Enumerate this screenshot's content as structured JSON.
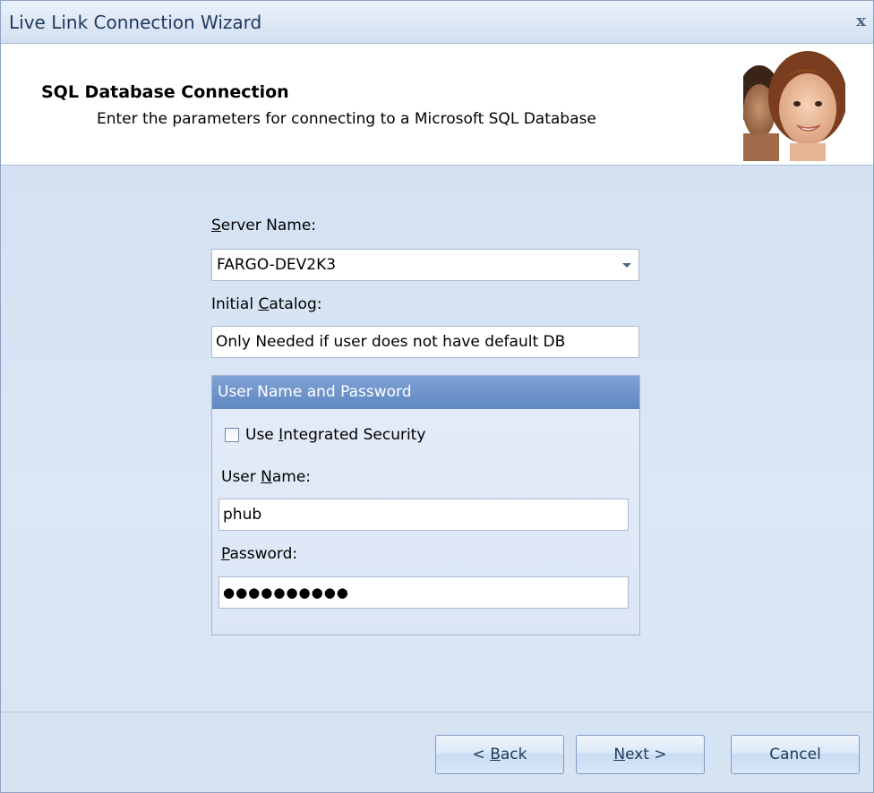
{
  "window": {
    "title": "Live Link Connection Wizard",
    "close_glyph": "x"
  },
  "header": {
    "title": "SQL Database Connection",
    "subtitle": "Enter the parameters for connecting to a Microsoft SQL Database",
    "photo_icon": "people-photo-icon"
  },
  "form": {
    "server_label": {
      "accesskey": "S",
      "rest": "erver Name:"
    },
    "server_value": "FARGO-DEV2K3",
    "catalog_label": {
      "pre": "Initial ",
      "accesskey": "C",
      "rest": "atalog:"
    },
    "catalog_value": "Only Needed if user does not have default DB",
    "group": {
      "title": "User Name and Password",
      "integrated_label": {
        "pre": "Use ",
        "accesskey": "I",
        "rest": "ntegrated Security"
      },
      "integrated_checked": false,
      "username_label": {
        "pre": "User ",
        "accesskey": "N",
        "rest": "ame:"
      },
      "username_value": "phub",
      "password_label": {
        "accesskey": "P",
        "rest": "assword:"
      },
      "password_value": "●●●●●●●●●●"
    }
  },
  "buttons": {
    "back": {
      "pre": "< ",
      "accesskey": "B",
      "rest": "ack"
    },
    "next": {
      "accesskey": "N",
      "rest": "ext >"
    },
    "cancel": "Cancel"
  },
  "colors": {
    "title_text": "#1e395b",
    "group_header": "#6f95cb",
    "body_bg": "#d6e3f3"
  }
}
